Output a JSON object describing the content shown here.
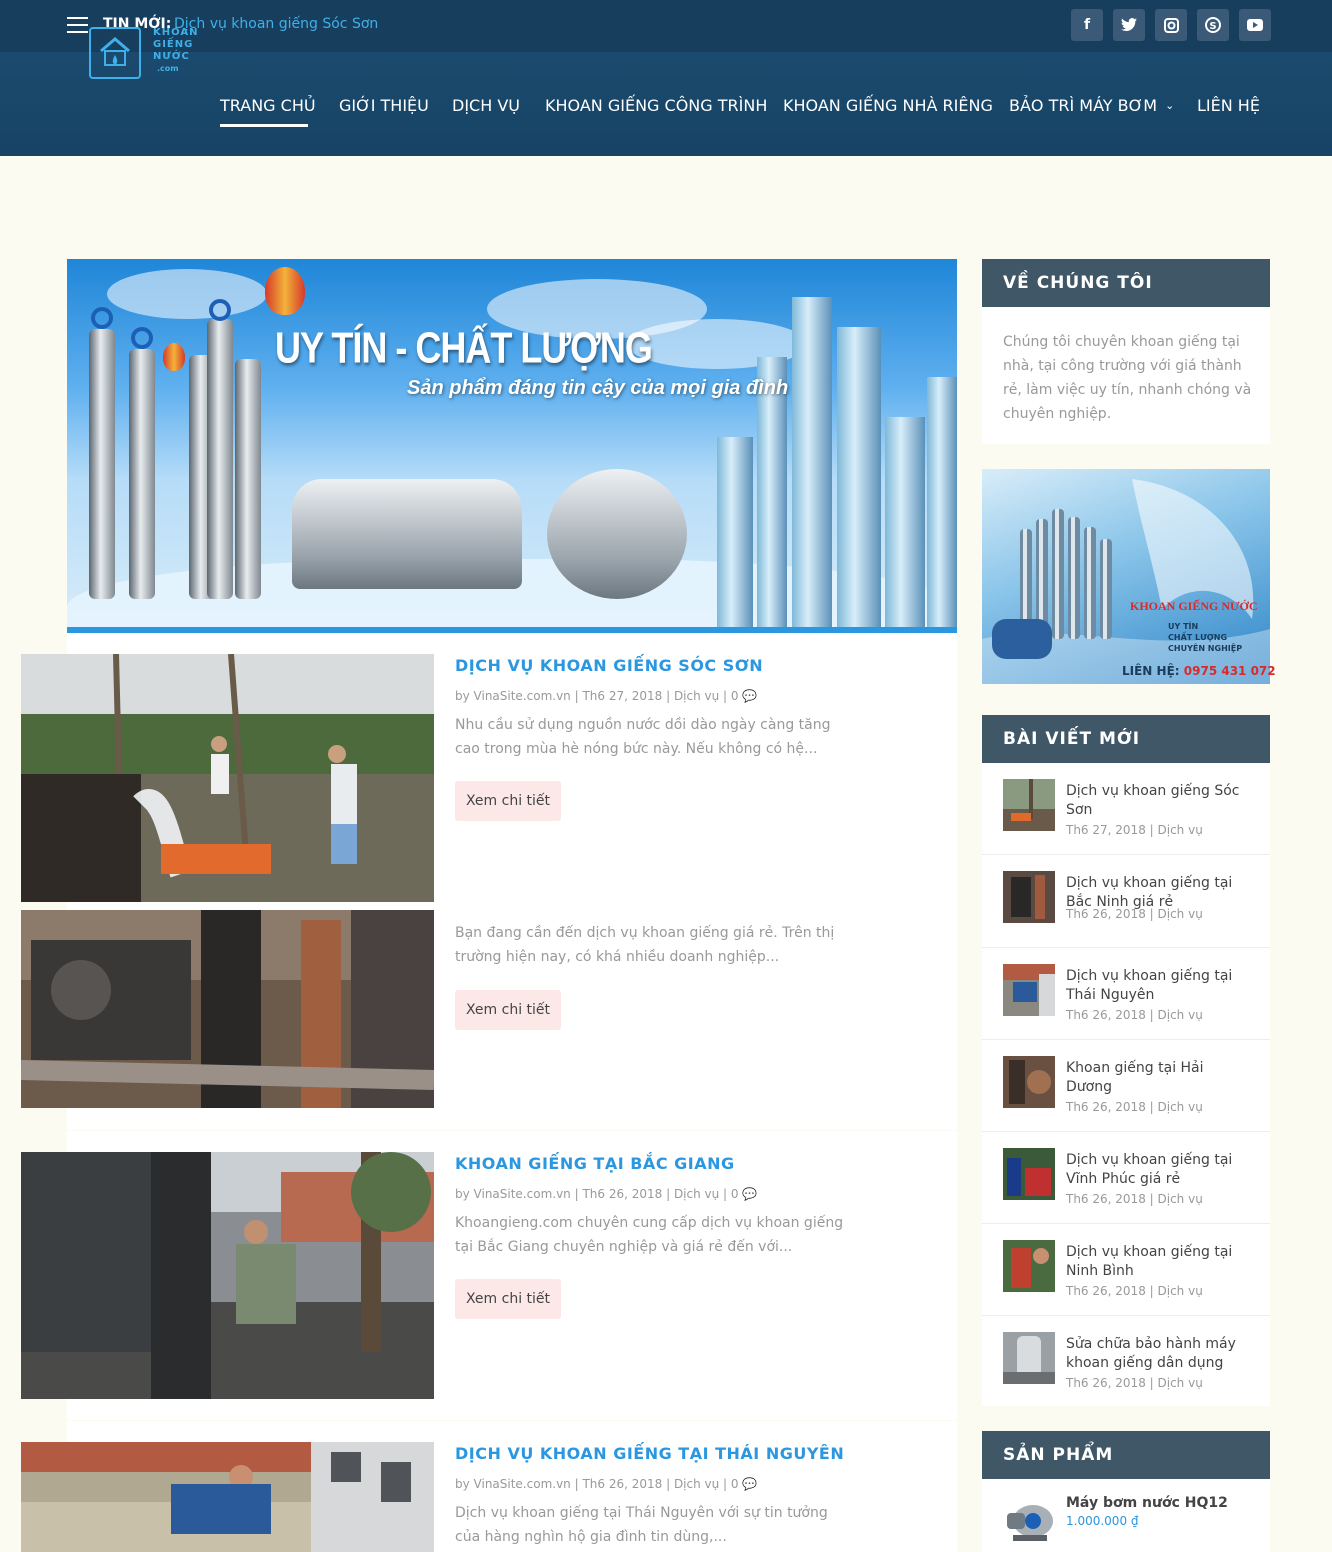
{
  "topbar": {
    "news_label": "TIN MỚI:",
    "news_link": "Dịch vụ khoan giếng Sóc Sơn",
    "socials": [
      {
        "icon": "facebook-icon",
        "glyph": "f"
      },
      {
        "icon": "twitter-icon",
        "glyph": "t"
      },
      {
        "icon": "instagram-icon",
        "glyph": "◘"
      },
      {
        "icon": "skype-icon",
        "glyph": "S"
      },
      {
        "icon": "youtube-icon",
        "glyph": "▶"
      }
    ]
  },
  "logo": {
    "line1": "KHOAN",
    "line2": "GIẾNG",
    "line3": "NƯỚC",
    "line4": ".com"
  },
  "nav": {
    "items": [
      {
        "label": "TRANG CHỦ",
        "active": true
      },
      {
        "label": "GIỚI THIỆU"
      },
      {
        "label": "DỊCH VỤ"
      },
      {
        "label": "KHOAN GIẾNG CÔNG TRÌNH"
      },
      {
        "label": "KHOAN GIẾNG NHÀ RIÊNG"
      },
      {
        "label": "BẢO TRÌ MÁY BƠM",
        "has_dropdown": true
      },
      {
        "label": "LIÊN HỆ"
      }
    ],
    "caret": "⌄"
  },
  "hero": {
    "title": "UY TÍN - CHẤT LƯỢNG",
    "subtitle": "Sản phẩm đáng tin cậy của mọi gia đình"
  },
  "posts": [
    {
      "title": "DỊCH VỤ KHOAN GIẾNG SÓC SƠN",
      "meta": "by VinaSite.com.vn | Th6 27, 2018 | Dịch vụ | 0 💬",
      "excerpt": "Nhu cầu sử dụng nguồn nước dồi dào ngày càng tăng cao trong mùa hè nóng bức này. Nếu không có hệ...",
      "button": "Xem chi tiết"
    },
    {
      "title": "",
      "meta": "",
      "excerpt": "Bạn đang cần đến dịch vụ khoan giếng giá rẻ. Trên thị trường hiện nay, có khá nhiều doanh nghiệp...",
      "button": "Xem chi tiết"
    },
    {
      "title": "KHOAN GIẾNG TẠI BẮC GIANG",
      "meta": "by VinaSite.com.vn | Th6 26, 2018 | Dịch vụ | 0 💬",
      "excerpt": "Khoangieng.com chuyên cung cấp dịch vụ khoan giếng tại Bắc Giang chuyên nghiệp và giá rẻ đến với...",
      "button": "Xem chi tiết"
    },
    {
      "title": "DỊCH VỤ KHOAN GIẾNG TẠI THÁI NGUYÊN",
      "meta": "by VinaSite.com.vn | Th6 26, 2018 | Dịch vụ | 0 💬",
      "excerpt": "Dịch vụ khoan giếng tại Thái Nguyên với sự tin tưởng của hàng nghìn hộ gia đình tin dùng,...",
      "button": ""
    }
  ],
  "sidebar": {
    "about": {
      "title": "VỀ CHÚNG TÔI",
      "text": "Chúng tôi chuyên khoan giếng tại nhà, tại công trường với giá thành rẻ, làm việc uy tín, nhanh chóng và chuyên nghiệp."
    },
    "ad": {
      "brand": "KHOAN GIẾNG NƯỚC",
      "lines": [
        "UY TÍN",
        "CHẤT LƯỢNG",
        "CHUYÊN NGHIỆP"
      ],
      "contact_label": "LIÊN HỆ:",
      "phone": "0975 431 072"
    },
    "recent": {
      "title": "BÀI VIẾT MỚI",
      "items": [
        {
          "title": "Dịch vụ khoan giếng Sóc Sơn",
          "meta": "Th6 27, 2018 | Dịch vụ"
        },
        {
          "title": "Dịch vụ khoan giếng tại Bắc Ninh giá rẻ",
          "meta": "Th6 26, 2018 | Dịch vụ"
        },
        {
          "title": "Dịch vụ khoan giếng tại Thái Nguyên",
          "meta": "Th6 26, 2018 | Dịch vụ"
        },
        {
          "title": "Khoan giếng tại Hải Dương",
          "meta": "Th6 26, 2018 | Dịch vụ"
        },
        {
          "title": "Dịch vụ khoan giếng tại Vĩnh Phúc giá rẻ",
          "meta": "Th6 26, 2018 | Dịch vụ"
        },
        {
          "title": "Dịch vụ khoan giếng tại Ninh Bình",
          "meta": "Th6 26, 2018 | Dịch vụ"
        },
        {
          "title": "Sửa chữa bảo hành máy khoan giếng dân dụng",
          "meta": "Th6 26, 2018 | Dịch vụ"
        }
      ]
    },
    "products": {
      "title": "SẢN PHẨM",
      "items": [
        {
          "name": "Máy bơm nước HQ12",
          "price": "1.000.000 ₫"
        }
      ]
    }
  }
}
